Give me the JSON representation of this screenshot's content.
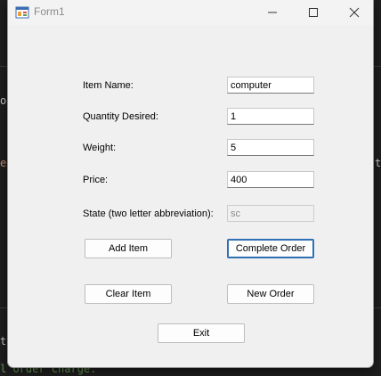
{
  "window": {
    "title": "Form1"
  },
  "background": {
    "fragments": [
      "o(",
      "ea",
      "t",
      "tt",
      "l order charge."
    ]
  },
  "form": {
    "fields": [
      {
        "label": "Item Name:",
        "value": "computer",
        "enabled": true
      },
      {
        "label": "Quantity Desired:",
        "value": "1",
        "enabled": true
      },
      {
        "label": "Weight:",
        "value": "5",
        "enabled": true
      },
      {
        "label": "Price:",
        "value": "400",
        "enabled": true
      },
      {
        "label": "State (two letter abbreviation):",
        "value": "sc",
        "enabled": false
      }
    ],
    "buttons": {
      "add_item": "Add Item",
      "complete_order": "Complete Order",
      "clear_item": "Clear Item",
      "new_order": "New Order",
      "exit": "Exit"
    }
  },
  "icons": {
    "app": "form-app-icon",
    "minimize": "minimize-icon",
    "maximize": "maximize-icon",
    "close": "close-icon"
  }
}
